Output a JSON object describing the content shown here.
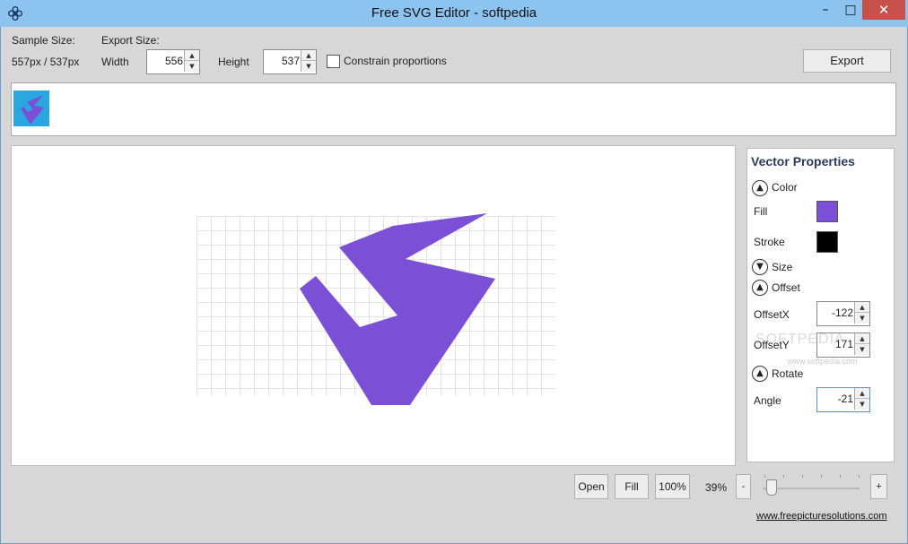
{
  "window": {
    "title": "Free SVG Editor - softpedia",
    "minimize_glyph": "–",
    "maximize_glyph": "□",
    "close_glyph": "✕"
  },
  "toolbar": {
    "sample_size_label": "Sample Size:",
    "sample_size_value": "557px / 537px",
    "export_size_label": "Export Size:",
    "width_label": "Width",
    "width_value": "556",
    "height_label": "Height",
    "height_value": "537",
    "constrain_label": "Constrain proportions",
    "constrain_checked": false,
    "export_label": "Export"
  },
  "properties": {
    "title": "Vector Properties",
    "color_section": "Color",
    "fill_label": "Fill",
    "fill_color": "#7b4fd6",
    "stroke_label": "Stroke",
    "stroke_color": "#000000",
    "size_section": "Size",
    "offset_section": "Offset",
    "offset_x_label": "OffsetX",
    "offset_x_value": "-122",
    "offset_y_label": "OffsetY",
    "offset_y_value": "171",
    "rotate_section": "Rotate",
    "angle_label": "Angle",
    "angle_value": "-21"
  },
  "bottom": {
    "open_label": "Open",
    "fill_label": "Fill",
    "hundred_label": "100%",
    "zoom_level": "39%",
    "zoom_minus": "-",
    "zoom_plus": "+",
    "footer_link": "www.freepicturesolutions.com"
  },
  "watermark": {
    "big": "SOFTPEDIA",
    "small": "www.softpedia.com"
  },
  "colors": {
    "titlebar": "#8cc3ef",
    "shape_fill": "#7b4fd6",
    "thumb_bg": "#2aa7de"
  }
}
